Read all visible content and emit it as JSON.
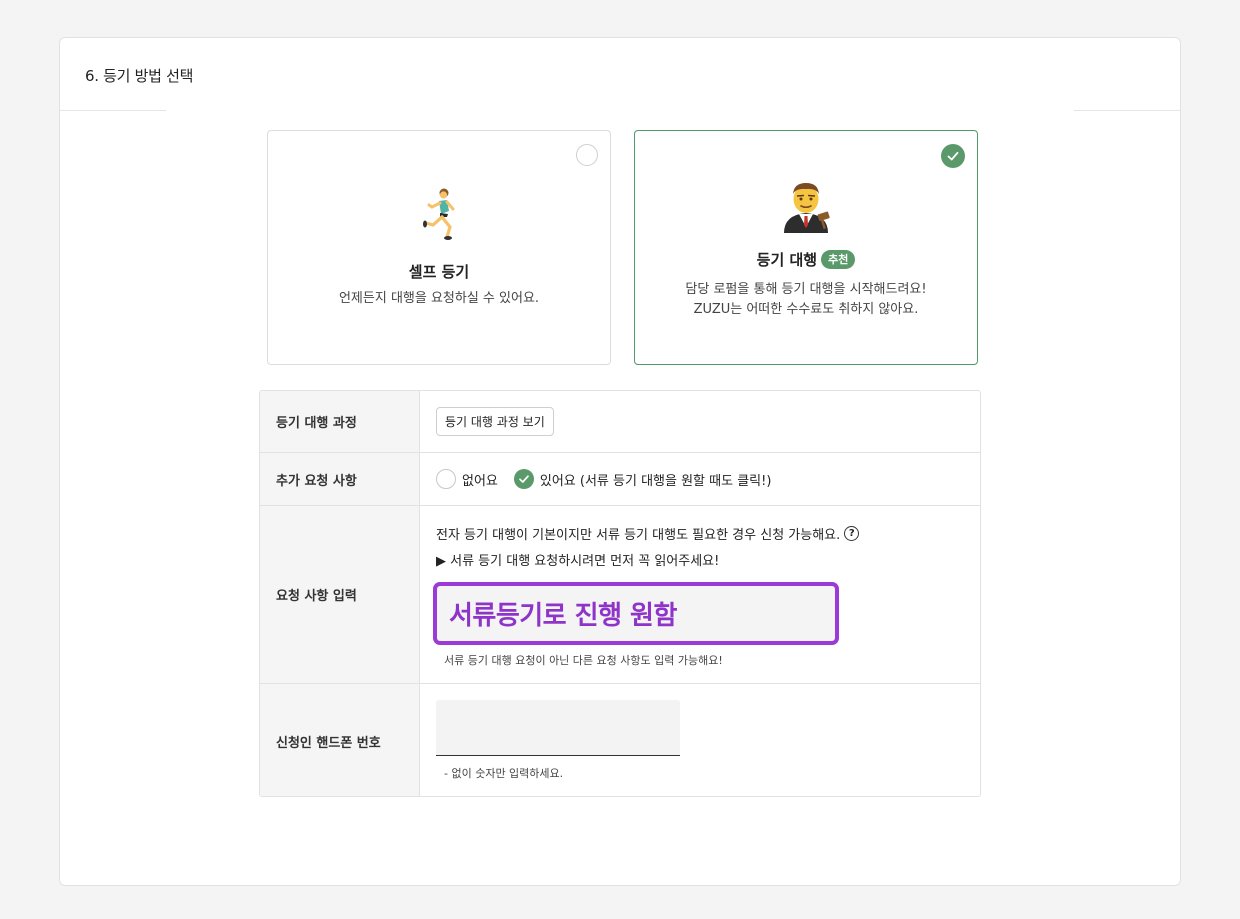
{
  "section": {
    "title": "6. 등기 방법 선택"
  },
  "options": [
    {
      "title": "셀프 등기",
      "description": [
        "언제든지 대행을 요청하실 수 있어요."
      ],
      "selected": false,
      "icon": "runner-icon"
    },
    {
      "title": "등기 대행",
      "badge": "추천",
      "description": [
        "담당 로펌을 통해 등기 대행을 시작해드려요!",
        "ZUZU는 어떠한 수수료도 취하지 않아요."
      ],
      "selected": true,
      "icon": "lawyer-icon"
    }
  ],
  "form": {
    "process": {
      "label": "등기 대행 과정",
      "button": "등기 대행 과정 보기"
    },
    "extra": {
      "label": "추가 요청 사항",
      "option_no": "없어요",
      "option_yes": "있어요 (서류 등기 대행을 원할 때도 클릭!)",
      "selected": "yes"
    },
    "request": {
      "label": "요청 사항 입력",
      "notice": "전자 등기 대행이 기본이지만 서류 등기 대행도 필요한 경우 신청 가능해요.",
      "help_symbol": "?",
      "guide": "▶ 서류 등기 대행 요청하시려면 먼저 꼭 읽어주세요!",
      "value": "서류등기로 진행 원함",
      "hint": "서류 등기 대행 요청이 아닌 다른 요청 사항도 입력 가능해요!"
    },
    "phone": {
      "label": "신청인 핸드폰 번호",
      "value": "",
      "hint": "- 없이 숫자만 입력하세요."
    }
  },
  "colors": {
    "accent_green": "#5a9a6a",
    "highlight_purple": "#9b3ad6"
  }
}
